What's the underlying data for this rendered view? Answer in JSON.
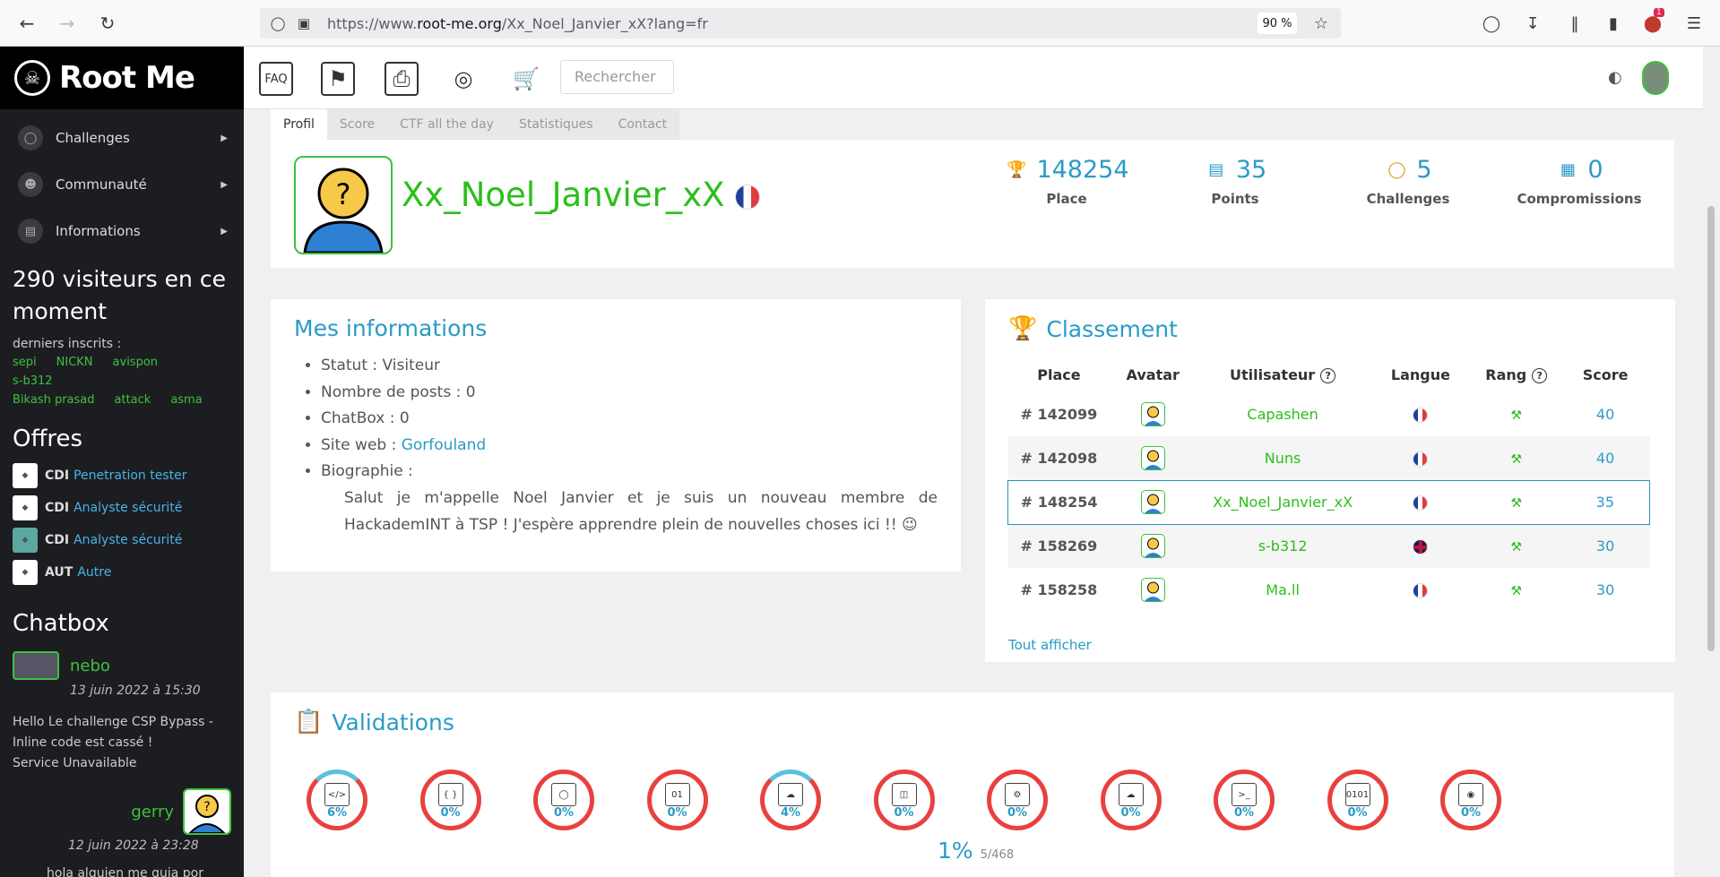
{
  "browser": {
    "url_prefix": "https://www.",
    "url_domain": "root-me.org",
    "url_path": "/Xx_Noel_Janvier_xX?lang=fr",
    "zoom": "90 %",
    "badge_count": "1"
  },
  "site": {
    "name": "Root Me"
  },
  "sidebar": {
    "menu": [
      {
        "label": "Challenges"
      },
      {
        "label": "Communauté"
      },
      {
        "label": "Informations"
      }
    ],
    "visitors": "290 visiteurs en ce moment",
    "recent_label": "derniers inscrits :",
    "recent_users": [
      "sepi",
      "NICKN",
      "avispon",
      "s-b312",
      "Bikash prasad",
      "attack",
      "asma"
    ],
    "offers_title": "Offres",
    "offers": [
      {
        "type": "CDI",
        "title": "Penetration tester"
      },
      {
        "type": "CDI",
        "title": "Analyste sécurité"
      },
      {
        "type": "CDI",
        "title": "Analyste sécurité"
      },
      {
        "type": "AUT",
        "title": "Autre"
      }
    ],
    "chatbox_title": "Chatbox",
    "chat": [
      {
        "user": "nebo",
        "date": "13 juin 2022 à 15:30",
        "message": [
          "Hello Le challenge CSP Bypass -",
          "Inline code est cassé !",
          "Service Unavailable"
        ]
      },
      {
        "user": "gerry",
        "date": "12 juin 2022 à 23:28",
        "message": [
          "hola alguien me guia por favor"
        ]
      }
    ]
  },
  "header": {
    "search_placeholder": "Rechercher"
  },
  "tabs": [
    "Profil",
    "Score",
    "CTF all the day",
    "Statistiques",
    "Contact"
  ],
  "profile": {
    "username": "Xx_Noel_Janvier_xX",
    "stats": [
      {
        "value": "148254",
        "label": "Place",
        "icon": "trophy-podium-icon"
      },
      {
        "value": "35",
        "label": "Points",
        "icon": "scoreboard-icon"
      },
      {
        "value": "5",
        "label": "Challenges",
        "icon": "shield-icon"
      },
      {
        "value": "0",
        "label": "Compromissions",
        "icon": "servers-icon"
      }
    ]
  },
  "infos": {
    "title": "Mes informations",
    "statut": "Statut : Visiteur",
    "posts": "Nombre de posts : 0",
    "chatbox": "ChatBox : 0",
    "website_label": "Site web :",
    "website": "Gorfouland",
    "bio_label": "Biographie :",
    "bio": "Salut je m'appelle Noel Janvier et je suis un nouveau membre de HackademINT à TSP ! J'espère apprendre plein de nouvelles choses ici !! 😉"
  },
  "ranking": {
    "title": "Classement",
    "headers": [
      "Place",
      "Avatar",
      "Utilisateur",
      "Langue",
      "Rang",
      "Score"
    ],
    "rows": [
      {
        "place": "# 142099",
        "user": "Capashen",
        "lang": "fr",
        "score": "40"
      },
      {
        "place": "# 142098",
        "user": "Nuns",
        "lang": "fr",
        "score": "40"
      },
      {
        "place": "# 148254",
        "user": "Xx_Noel_Janvier_xX",
        "lang": "fr",
        "score": "35"
      },
      {
        "place": "# 158269",
        "user": "s-b312",
        "lang": "en",
        "score": "30"
      },
      {
        "place": "# 158258",
        "user": "Ma.ll",
        "lang": "fr",
        "score": "30"
      }
    ],
    "show_all": "Tout afficher"
  },
  "validations": {
    "title": "Validations",
    "categories": [
      {
        "pct": "6%",
        "fraction": 0.06,
        "icon": "web-client-icon"
      },
      {
        "pct": "0%",
        "fraction": 0,
        "icon": "programming-icon"
      },
      {
        "pct": "0%",
        "fraction": 0,
        "icon": "cryptanalysis-icon"
      },
      {
        "pct": "0%",
        "fraction": 0,
        "icon": "steganography-icon"
      },
      {
        "pct": "4%",
        "fraction": 0.04,
        "icon": "web-server-icon"
      },
      {
        "pct": "0%",
        "fraction": 0,
        "icon": "cracking-icon"
      },
      {
        "pct": "0%",
        "fraction": 0,
        "icon": "app-system-icon"
      },
      {
        "pct": "0%",
        "fraction": 0,
        "icon": "network-icon"
      },
      {
        "pct": "0%",
        "fraction": 0,
        "icon": "app-script-icon"
      },
      {
        "pct": "0%",
        "fraction": 0,
        "icon": "forensic-icon"
      },
      {
        "pct": "0%",
        "fraction": 0,
        "icon": "realist-icon"
      }
    ],
    "overall_pct": "1%",
    "overall_count": "5/468"
  }
}
